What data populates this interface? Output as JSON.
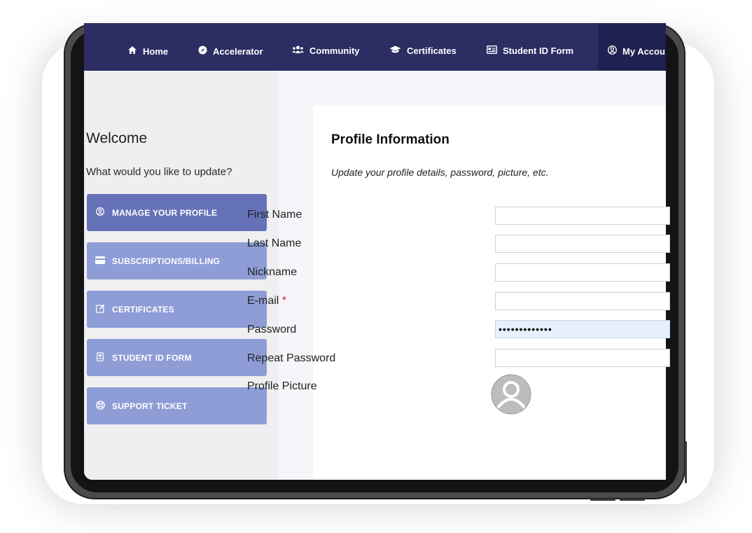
{
  "nav": {
    "items": [
      {
        "label": "Home",
        "icon": "home-icon"
      },
      {
        "label": "Accelerator",
        "icon": "compass-icon"
      },
      {
        "label": "Community",
        "icon": "users-icon"
      },
      {
        "label": "Certificates",
        "icon": "graduation-cap-icon"
      },
      {
        "label": "Student ID Form",
        "icon": "id-card-icon"
      },
      {
        "label": "My Accou",
        "icon": "user-circle-icon"
      }
    ]
  },
  "sidebar": {
    "welcome": "Welcome",
    "prompt": "What would you like to update?",
    "buttons": [
      {
        "label": "MANAGE YOUR PROFILE",
        "icon": "user-circle-icon"
      },
      {
        "label": "SUBSCRIPTIONS/BILLING",
        "icon": "credit-card-icon"
      },
      {
        "label": "CERTIFICATES",
        "icon": "edit-icon"
      },
      {
        "label": "STUDENT ID FORM",
        "icon": "id-badge-icon"
      },
      {
        "label": "SUPPORT TICKET",
        "icon": "life-ring-icon"
      }
    ]
  },
  "profile": {
    "title": "Profile Information",
    "subtitle": "Update your profile details, password, picture, etc.",
    "fields": [
      {
        "label": "First Name",
        "value": ""
      },
      {
        "label": "Last Name",
        "value": ""
      },
      {
        "label": "Nickname",
        "value": ""
      },
      {
        "label": "E-mail",
        "required": "*",
        "value": ""
      },
      {
        "label": "Password",
        "value": "•••••••••••••"
      },
      {
        "label": "Repeat Password",
        "value": ""
      }
    ],
    "picture_label": "Profile Picture"
  },
  "colors": {
    "navbar": "#2b2d63",
    "sidebar_button": "#8e9dd6",
    "sidebar_button_active": "#6672b8",
    "required": "#d22222"
  }
}
